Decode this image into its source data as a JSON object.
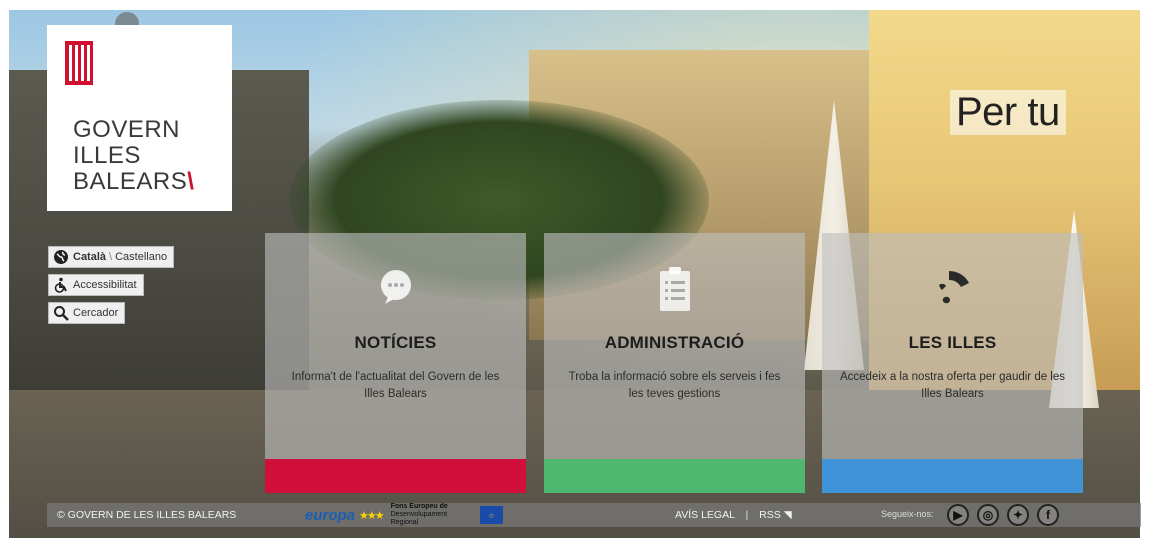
{
  "brand": {
    "line1": "GOVERN",
    "line2": "ILLES",
    "line3": "BALEARS",
    "slash": "\\"
  },
  "side": {
    "lang_active": "Català",
    "lang_sep": "\\",
    "lang_other": "Castellano",
    "accessibility": "Accessibilitat",
    "search": "Cercador"
  },
  "hero": {
    "tagline": "Per tu"
  },
  "cards": [
    {
      "title": "NOTÍCIES",
      "desc": "Informa't de l'actualitat del Govern de les Illes Balears",
      "icon": "chat-bubble-icon",
      "color": "#d0103a"
    },
    {
      "title": "ADMINISTRACIÓ",
      "desc": "Troba la informació sobre els serveis i fes les teves gestions",
      "icon": "document-list-icon",
      "color": "#4fb870"
    },
    {
      "title": "LES ILLES",
      "desc": "Accedeix a la nostra oferta per gaudir de les Illes Balears",
      "icon": "islands-icon",
      "color": "#3f93d6"
    }
  ],
  "footer": {
    "copyright": "© GOVERN DE LES ILLES BALEARS",
    "eu_word": "europa",
    "eu_fons": "Fons Europeu de",
    "eu_fons2": "Desenvolupament Regional",
    "legal": "AVÍS LEGAL",
    "rss": "RSS",
    "follow": "Segueix-nos:",
    "social": [
      "youtube-icon",
      "instagram-icon",
      "twitter-icon",
      "facebook-icon"
    ]
  }
}
